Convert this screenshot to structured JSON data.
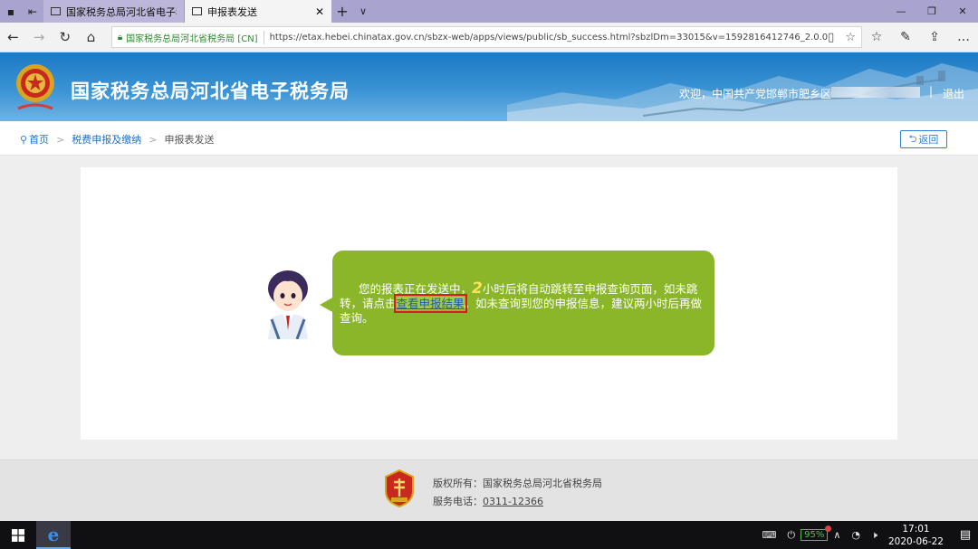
{
  "browser": {
    "tabs": [
      {
        "title": "国家税务总局河北省电子税",
        "active": false
      },
      {
        "title": "申报表发送",
        "active": true
      }
    ],
    "new_tab_symbol": "+",
    "site_identity": "国家税务总局河北省税务局 [CN]",
    "url": "https://etax.hebei.chinatax.gov.cn/sbzx-web/apps/views/public/sb_success.html?sbzlDm=33015&v=1592816412746_2.0.0"
  },
  "header": {
    "site_title": "国家税务总局河北省电子税务局",
    "welcome": "欢迎，中国共产党邯郸市肥乡区",
    "separator": "|",
    "logout": "退出"
  },
  "breadcrumb": {
    "home": "首页",
    "level1": "税费申报及缴纳",
    "current": "申报表发送",
    "sep": ">"
  },
  "back_button": "返回",
  "message": {
    "part1": "您的报表正在发送中，",
    "hours": "2",
    "part2": "小时后将自动跳转至申报查询页面，如未跳转，请点击",
    "link": "查看申报结果",
    "part3": "。如未查询到您的申报信息，建议两小时后再做查询。"
  },
  "footer": {
    "copyright": "版权所有：国家税务总局河北省税务局",
    "phone_label": "服务电话：",
    "phone": "0311-12366"
  },
  "taskbar": {
    "battery": "95%",
    "time": "17:01",
    "date": "2020-06-22"
  },
  "colors": {
    "header_blue": "#1d79c4",
    "bubble_green": "#8bb62a",
    "link_blue": "#1f6fc5",
    "highlight_red": "#d21e1e"
  }
}
